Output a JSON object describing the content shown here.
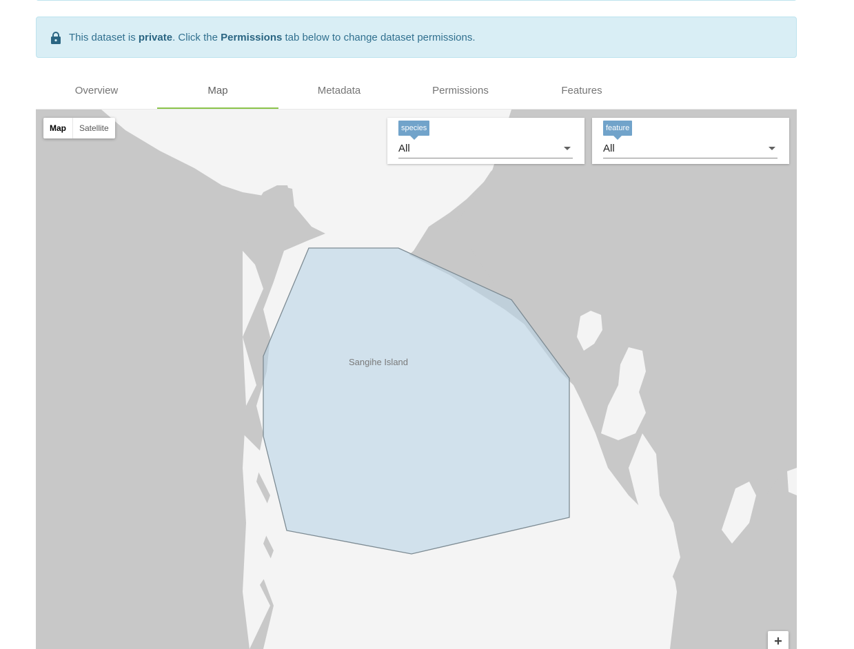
{
  "alert": {
    "prefix": "This dataset is ",
    "status": "private",
    "middle": ". Click the ",
    "tab_ref": "Permissions",
    "suffix": " tab below to change dataset permissions.",
    "icon": "lock-icon"
  },
  "tabs": [
    {
      "label": "Overview",
      "active": false
    },
    {
      "label": "Map",
      "active": true
    },
    {
      "label": "Metadata",
      "active": false
    },
    {
      "label": "Permissions",
      "active": false
    },
    {
      "label": "Features",
      "active": false
    }
  ],
  "map": {
    "type_control": {
      "map_label": "Map",
      "satellite_label": "Satellite",
      "selected": "Map"
    },
    "filters": [
      {
        "name": "species",
        "tag": "species",
        "value": "All"
      },
      {
        "name": "feature",
        "tag": "feature",
        "value": "All"
      }
    ],
    "place_label": "Sangihe Island",
    "zoom_in_label": "+",
    "colors": {
      "land": "#f4f4f4",
      "water": "#c8c8c8",
      "polygon_fill": "#b9d3e6",
      "polygon_stroke": "#7d8b93",
      "accent": "#8bc34a"
    }
  }
}
